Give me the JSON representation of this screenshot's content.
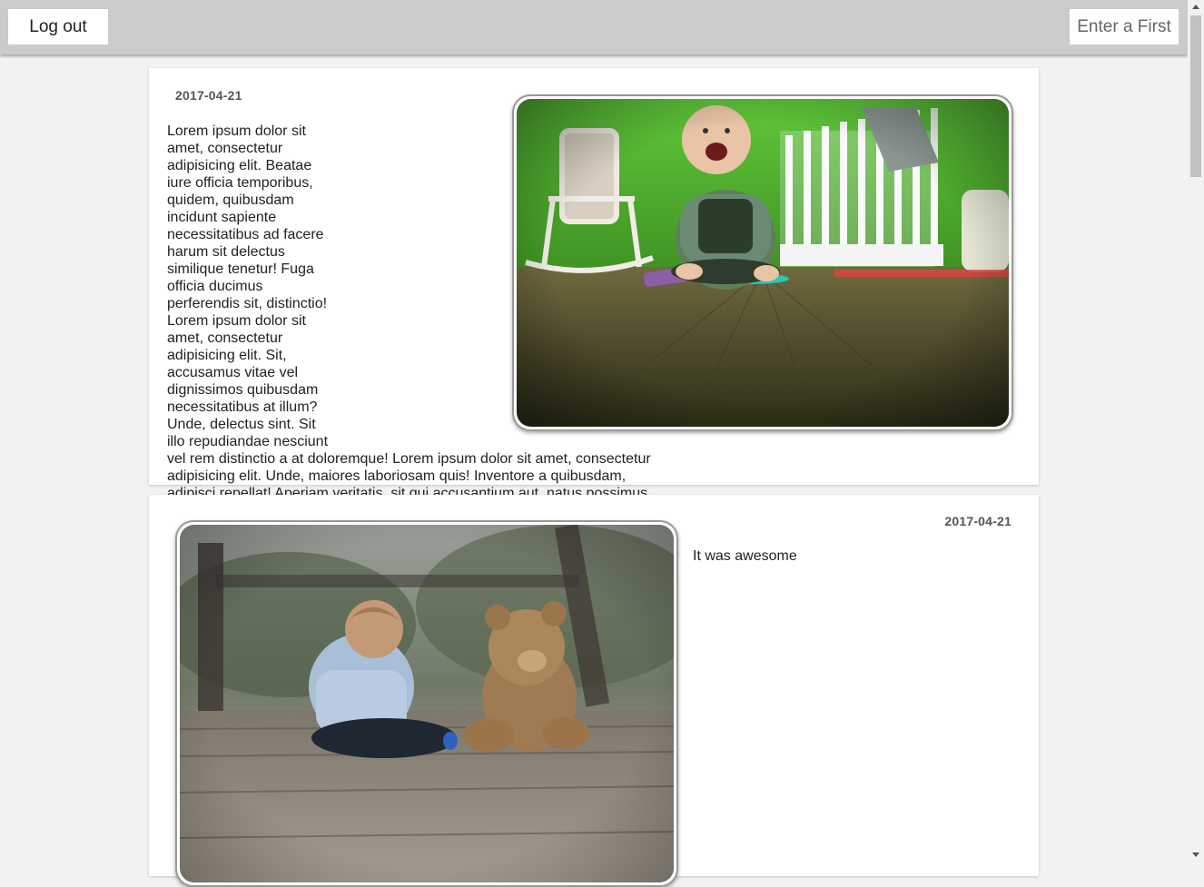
{
  "header": {
    "logout_label": "Log out",
    "enter_label": "Enter a First"
  },
  "posts": [
    {
      "date": "2017-04-21",
      "text": "Lorem ipsum dolor sit amet, consectetur adipisicing elit. Beatae iure officia temporibus, quidem, quibusdam incidunt sapiente necessitatibus ad facere harum sit delectus similique tenetur! Fuga officia ducimus perferendis sit, distinctio! Lorem ipsum dolor sit amet, consectetur adipisicing elit. Sit, accusamus vitae vel dignissimos quibusdam necessitatibus at illum? Unde, delectus sint. Sit illo repudiandae nesciunt vel rem distinctio a at doloremque! Lorem ipsum dolor sit amet, consectetur adipisicing elit. Unde, maiores laboriosam quis! Inventore a quibusdam, adipisci repellat! Aperiam veritatis, sit qui accusantium aut, natus possimus facere ipsa, perferendis illo rem. Lorem ipsum dolor sit amet, consectetur adipisicing elit. Doloremque molestiae nisi distinctio assumenda possimus molestias sapiente, consectetur ut sint, eaque, quam? Eligendi aperiam ab architecto ducimus dicta, quae provident aspernatur.",
      "image": "baby-in-nursery-photo"
    },
    {
      "date": "2017-04-21",
      "text": "It was awesome",
      "image": "child-with-teddy-bear-photo"
    }
  ],
  "colors": {
    "topbar": "#cbcbcb",
    "background": "#f2f2f2",
    "card": "#ffffff"
  }
}
